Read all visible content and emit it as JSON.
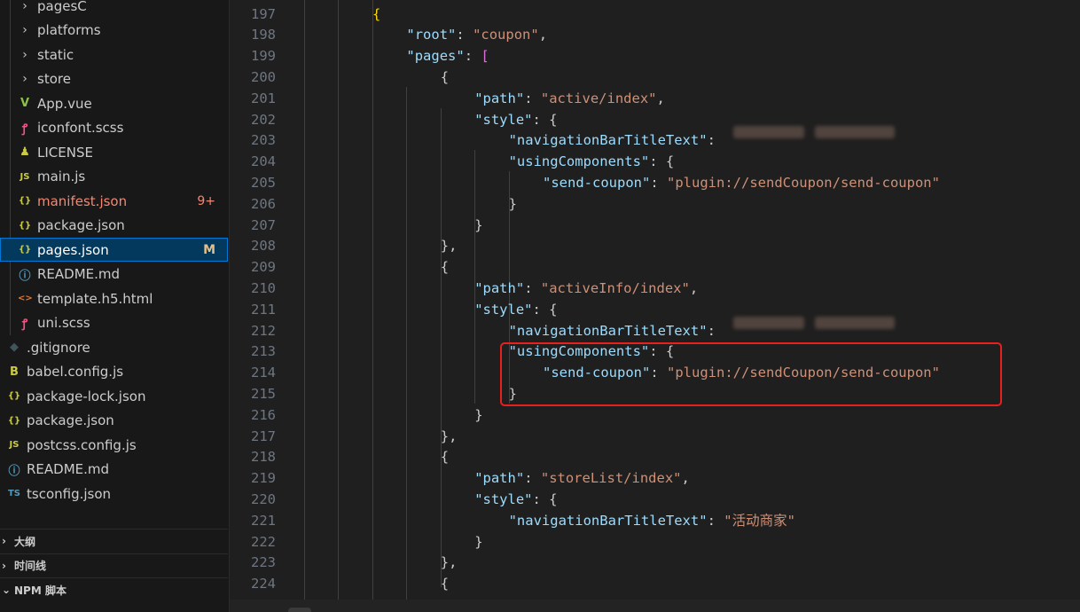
{
  "explorer": {
    "items": [
      {
        "label": "pagesC",
        "icon": "chevron-right-icon",
        "glyph": "›",
        "color": "#cccccc",
        "badge": ""
      },
      {
        "label": "platforms",
        "icon": "chevron-right-icon",
        "glyph": "›",
        "color": "#cccccc",
        "badge": ""
      },
      {
        "label": "static",
        "icon": "chevron-right-icon",
        "glyph": "›",
        "color": "#cccccc",
        "badge": ""
      },
      {
        "label": "store",
        "icon": "chevron-right-icon",
        "glyph": "›",
        "color": "#cccccc",
        "badge": ""
      },
      {
        "label": "App.vue",
        "icon": "vue-icon",
        "glyph": "V",
        "color": "#cccccc",
        "badge": ""
      },
      {
        "label": "iconfont.scss",
        "icon": "sass-icon",
        "glyph": "ꝭ",
        "color": "#cccccc",
        "badge": ""
      },
      {
        "label": "LICENSE",
        "icon": "license-icon",
        "glyph": "♟",
        "color": "#cccccc",
        "badge": ""
      },
      {
        "label": "main.js",
        "icon": "javascript-icon",
        "glyph": "JS",
        "color": "#cccccc",
        "badge": ""
      },
      {
        "label": "manifest.json",
        "icon": "json-icon",
        "glyph": "{}",
        "color": "#f48771",
        "badge": "9+"
      },
      {
        "label": "package.json",
        "icon": "json-icon",
        "glyph": "{}",
        "color": "#cccccc",
        "badge": ""
      },
      {
        "label": "pages.json",
        "icon": "json-icon",
        "glyph": "{}",
        "color": "#ffffff",
        "badge": "M"
      },
      {
        "label": "README.md",
        "icon": "info-icon",
        "glyph": "ⓘ",
        "color": "#cccccc",
        "badge": ""
      },
      {
        "label": "template.h5.html",
        "icon": "html-icon",
        "glyph": "<>",
        "color": "#cccccc",
        "badge": ""
      },
      {
        "label": "uni.scss",
        "icon": "sass-icon",
        "glyph": "ꝭ",
        "color": "#cccccc",
        "badge": ""
      },
      {
        "label": ".gitignore",
        "icon": "git-icon",
        "glyph": "◆",
        "color": "#cccccc",
        "badge": ""
      },
      {
        "label": "babel.config.js",
        "icon": "babel-icon",
        "glyph": "B",
        "color": "#cccccc",
        "badge": ""
      },
      {
        "label": "package-lock.json",
        "icon": "json-icon",
        "glyph": "{}",
        "color": "#cccccc",
        "badge": ""
      },
      {
        "label": "package.json",
        "icon": "json-icon",
        "glyph": "{}",
        "color": "#cccccc",
        "badge": ""
      },
      {
        "label": "postcss.config.js",
        "icon": "javascript-icon",
        "glyph": "JS",
        "color": "#cccccc",
        "badge": ""
      },
      {
        "label": "README.md",
        "icon": "info-icon",
        "glyph": "ⓘ",
        "color": "#cccccc",
        "badge": ""
      },
      {
        "label": "tsconfig.json",
        "icon": "typescript-icon",
        "glyph": "TS",
        "color": "#cccccc",
        "badge": ""
      }
    ],
    "icon_colors": {
      "chevron-right-icon": "#c5c5c5",
      "vue-icon": "#8dc149",
      "sass-icon": "#f55385",
      "license-icon": "#cbcb41",
      "javascript-icon": "#cbcb41",
      "json-icon": "#cbcb41",
      "info-icon": "#519aba",
      "html-icon": "#e37933",
      "git-icon": "#41535b",
      "babel-icon": "#cbcb41",
      "typescript-icon": "#519aba"
    },
    "sections": [
      {
        "arrow": "›",
        "label": "大纲"
      },
      {
        "arrow": "›",
        "label": "时间线"
      },
      {
        "arrow": "⌄",
        "label": "NPM 脚本"
      }
    ]
  },
  "editor": {
    "lines": [
      {
        "n": "197",
        "t": [
          [
            "br",
            "{"
          ]
        ]
      },
      {
        "n": "198",
        "t": [
          [
            "k",
            "\"root\""
          ],
          [
            "p",
            ": "
          ],
          [
            "s",
            "\"coupon\""
          ],
          [
            "p",
            ","
          ]
        ]
      },
      {
        "n": "199",
        "t": [
          [
            "k",
            "\"pages\""
          ],
          [
            "p",
            ": "
          ],
          [
            "bl",
            "["
          ]
        ]
      },
      {
        "n": "200",
        "t": [
          [
            "p",
            "{"
          ]
        ]
      },
      {
        "n": "201",
        "t": [
          [
            "k",
            "\"path\""
          ],
          [
            "p",
            ": "
          ],
          [
            "s",
            "\"active/index\""
          ],
          [
            "p",
            ","
          ]
        ]
      },
      {
        "n": "202",
        "t": [
          [
            "k",
            "\"style\""
          ],
          [
            "p",
            ": {"
          ]
        ]
      },
      {
        "n": "203",
        "t": [
          [
            "k",
            "\"navigationBarTitleText\""
          ],
          [
            "p",
            ": "
          ]
        ]
      },
      {
        "n": "204",
        "t": [
          [
            "k",
            "\"usingComponents\""
          ],
          [
            "p",
            ": {"
          ]
        ]
      },
      {
        "n": "205",
        "t": [
          [
            "k",
            "\"send-coupon\""
          ],
          [
            "p",
            ": "
          ],
          [
            "s",
            "\"plugin://sendCoupon/send-coupon\""
          ]
        ]
      },
      {
        "n": "206",
        "t": [
          [
            "p",
            "}"
          ]
        ]
      },
      {
        "n": "207",
        "t": [
          [
            "p",
            "}"
          ]
        ]
      },
      {
        "n": "208",
        "t": [
          [
            "p",
            "},"
          ]
        ]
      },
      {
        "n": "209",
        "t": [
          [
            "p",
            "{"
          ]
        ]
      },
      {
        "n": "210",
        "t": [
          [
            "k",
            "\"path\""
          ],
          [
            "p",
            ": "
          ],
          [
            "s",
            "\"activeInfo/index\""
          ],
          [
            "p",
            ","
          ]
        ]
      },
      {
        "n": "211",
        "t": [
          [
            "k",
            "\"style\""
          ],
          [
            "p",
            ": {"
          ]
        ]
      },
      {
        "n": "212",
        "t": [
          [
            "k",
            "\"navigationBarTitleText\""
          ],
          [
            "p",
            ": "
          ]
        ]
      },
      {
        "n": "213",
        "t": [
          [
            "k",
            "\"usingComponents\""
          ],
          [
            "p",
            ": {"
          ]
        ]
      },
      {
        "n": "214",
        "t": [
          [
            "k",
            "\"send-coupon\""
          ],
          [
            "p",
            ": "
          ],
          [
            "s",
            "\"plugin://sendCoupon/send-coupon\""
          ]
        ]
      },
      {
        "n": "215",
        "t": [
          [
            "p",
            "}"
          ]
        ]
      },
      {
        "n": "216",
        "t": [
          [
            "p",
            "}"
          ]
        ]
      },
      {
        "n": "217",
        "t": [
          [
            "p",
            "},"
          ]
        ]
      },
      {
        "n": "218",
        "t": [
          [
            "p",
            "{"
          ]
        ]
      },
      {
        "n": "219",
        "t": [
          [
            "k",
            "\"path\""
          ],
          [
            "p",
            ": "
          ],
          [
            "s",
            "\"storeList/index\""
          ],
          [
            "p",
            ","
          ]
        ]
      },
      {
        "n": "220",
        "t": [
          [
            "k",
            "\"style\""
          ],
          [
            "p",
            ": {"
          ]
        ]
      },
      {
        "n": "221",
        "t": [
          [
            "k",
            "\"navigationBarTitleText\""
          ],
          [
            "p",
            ": "
          ],
          [
            "s",
            "\"活动商家\""
          ]
        ]
      },
      {
        "n": "222",
        "t": [
          [
            "p",
            "}"
          ]
        ]
      },
      {
        "n": "223",
        "t": [
          [
            "p",
            "},"
          ]
        ]
      },
      {
        "n": "224",
        "t": [
          [
            "p",
            "{"
          ]
        ]
      }
    ]
  }
}
